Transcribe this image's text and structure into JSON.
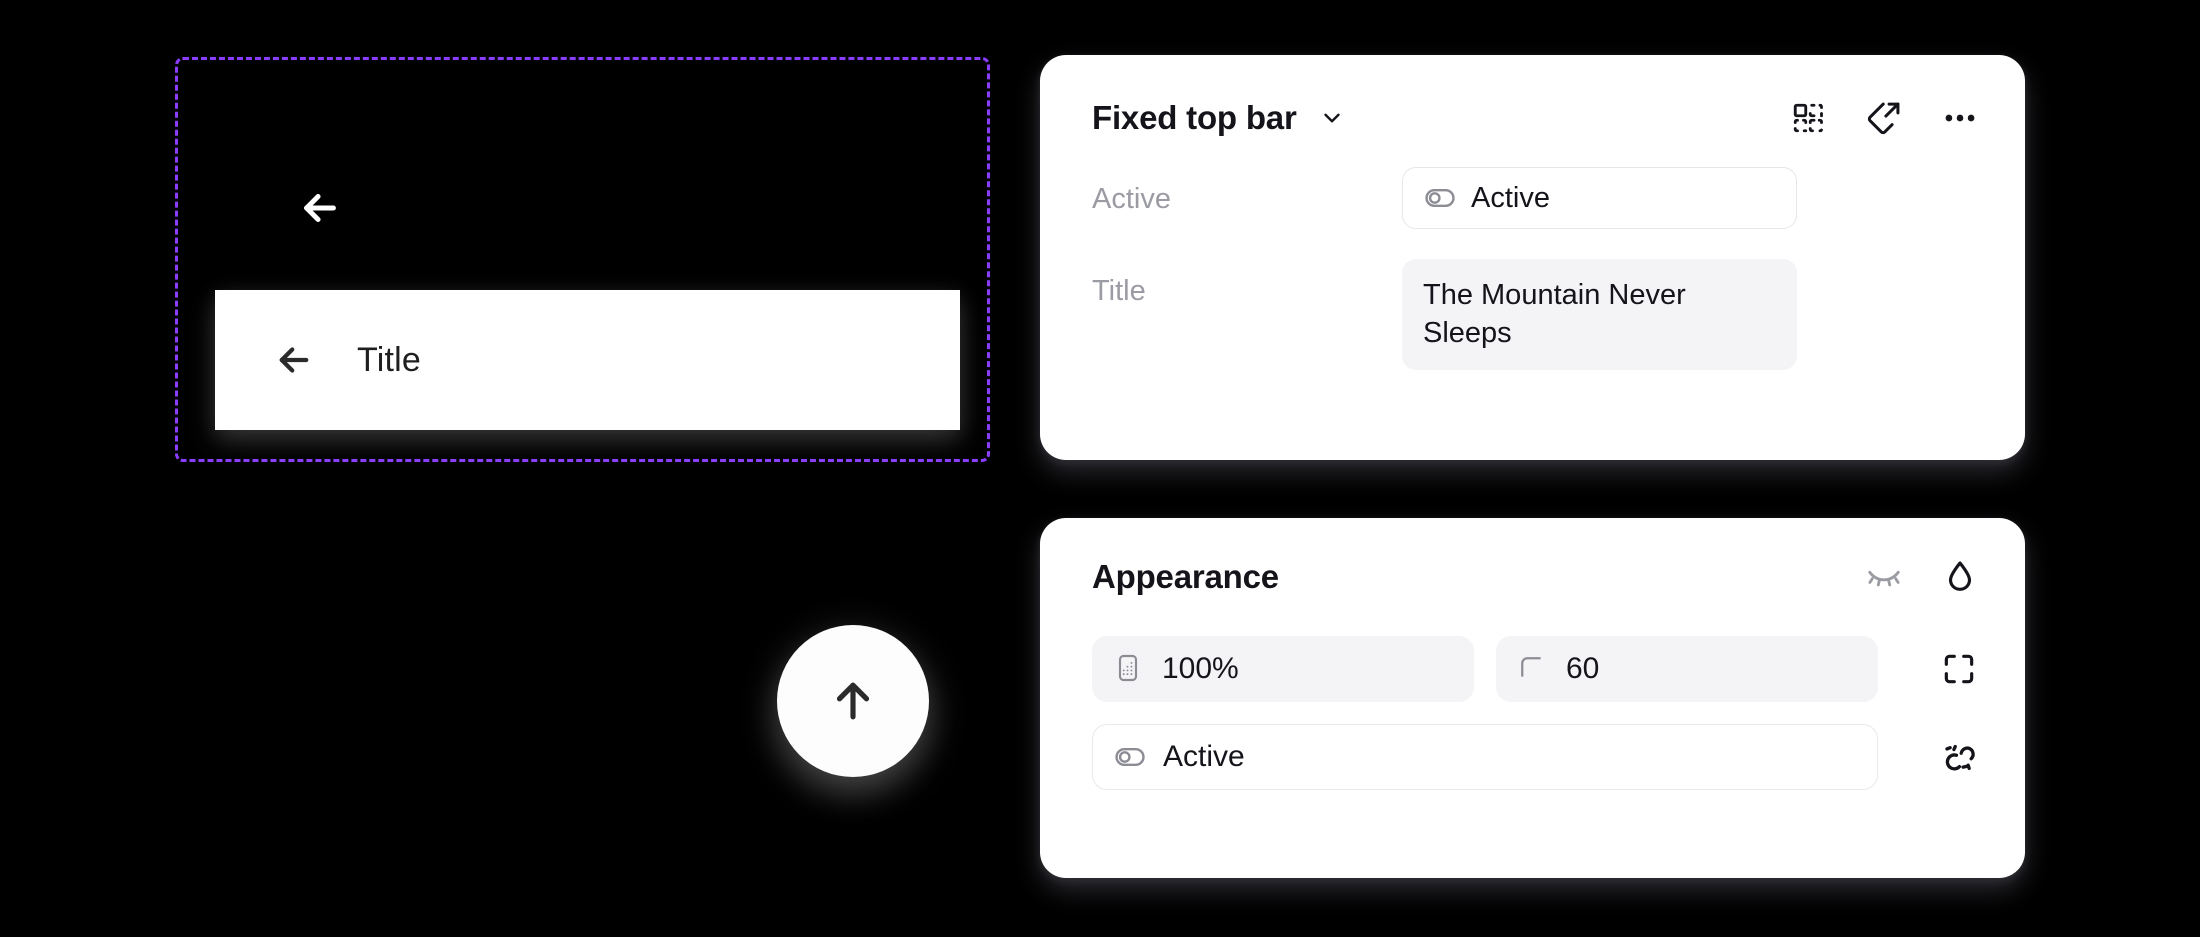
{
  "canvas": {
    "background_color": "#000000",
    "selection_color": "#8b3dff",
    "preview": {
      "back_icon": "arrow-left-icon",
      "bar": {
        "back_icon": "arrow-left-icon",
        "title": "Title"
      }
    },
    "fab": {
      "icon": "arrow-up-icon"
    }
  },
  "inspector": {
    "layer_card": {
      "title": "Fixed top bar",
      "dropdown_icon": "chevron-down-icon",
      "header_actions": [
        {
          "name": "component-variants-icon",
          "label": "Variants"
        },
        {
          "name": "detach-external-icon",
          "label": "Detach"
        },
        {
          "name": "more-options-icon",
          "label": "More"
        }
      ],
      "properties": [
        {
          "label": "Active",
          "icon": "toggle-switch-icon",
          "value": "Active",
          "style": "bordered"
        },
        {
          "label": "Title",
          "icon": null,
          "value": "The Mountain Never Sleeps",
          "style": "filled"
        }
      ]
    },
    "appearance_card": {
      "title": "Appearance",
      "header_actions": [
        {
          "name": "eye-off-icon",
          "label": "Hide",
          "muted": true
        },
        {
          "name": "opacity-droplet-icon",
          "label": "Blend",
          "muted": false
        }
      ],
      "rows": [
        {
          "fields": [
            {
              "icon": "opacity-icon",
              "value": "100%",
              "style": "filled",
              "width": "half"
            },
            {
              "icon": "corner-radius-icon",
              "value": "60",
              "style": "filled",
              "width": "half"
            }
          ],
          "trailing_icon": "independent-corners-icon"
        },
        {
          "fields": [
            {
              "icon": "toggle-switch-icon",
              "value": "Active",
              "style": "bordered",
              "width": "full"
            }
          ],
          "trailing_icon": "dashed-link-icon"
        }
      ]
    }
  }
}
